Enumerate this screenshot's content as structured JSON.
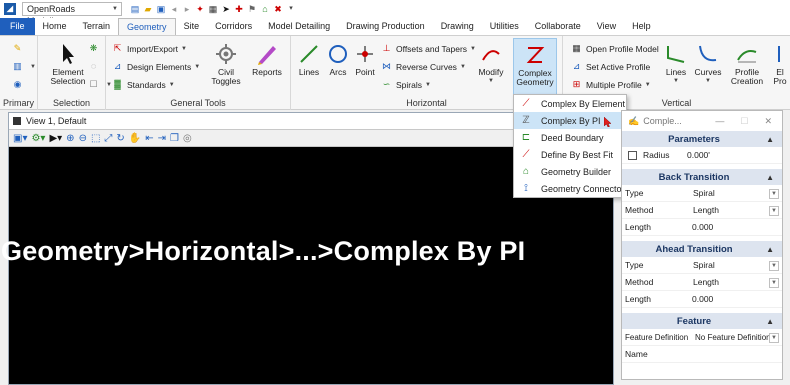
{
  "titlebar": {
    "workspace": "OpenRoads Modeling"
  },
  "tabs": [
    "File",
    "Home",
    "Terrain",
    "Geometry",
    "Site",
    "Corridors",
    "Model Detailing",
    "Drawing Production",
    "Drawing",
    "Utilities",
    "Collaborate",
    "View",
    "Help"
  ],
  "ribbon": {
    "groups": {
      "primary": "Primary",
      "selection": "Selection",
      "general_tools": "General Tools",
      "horizontal": "Horizontal",
      "vertical": "Vertical"
    },
    "buttons": {
      "element_selection": "Element\nSelection",
      "import_export": "Import/Export",
      "design_elements": "Design Elements",
      "standards": "Standards",
      "civil_toggles": "Civil\nToggles",
      "reports": "Reports",
      "lines": "Lines",
      "arcs": "Arcs",
      "point": "Point",
      "offsets_tapers": "Offsets and Tapers",
      "reverse_curves": "Reverse Curves",
      "spirals": "Spirals",
      "modify": "Modify",
      "complex_geometry": "Complex\nGeometry",
      "open_profile_model": "Open Profile Model",
      "set_active_profile": "Set Active Profile",
      "multiple_profile": "Multiple Profile",
      "v_lines": "Lines",
      "v_curves": "Curves",
      "profile_creation": "Profile\nCreation",
      "el_cut": "El",
      "pro_cut": "Pro"
    }
  },
  "view": {
    "title": "View 1, Default",
    "overlay": "Geometry>Horizontal>...>Complex By PI"
  },
  "menu": {
    "items": [
      {
        "label": "Complex By Element",
        "icon": "complex-element-icon"
      },
      {
        "label": "Complex By PI",
        "icon": "complex-pi-icon"
      },
      {
        "label": "Deed Boundary",
        "icon": "deed-boundary-icon"
      },
      {
        "label": "Define By Best Fit",
        "icon": "best-fit-icon"
      },
      {
        "label": "Geometry Builder",
        "icon": "geometry-builder-icon"
      },
      {
        "label": "Geometry Connector",
        "icon": "geometry-connector-icon"
      }
    ],
    "highlighted_index": 1
  },
  "panel": {
    "title": "Comple...",
    "sections": {
      "parameters": {
        "title": "Parameters",
        "radius_label": "Radius",
        "radius_value": "0.000'"
      },
      "back_transition": {
        "title": "Back Transition",
        "type_label": "Type",
        "type_value": "Spiral",
        "method_label": "Method",
        "method_value": "Length",
        "length_label": "Length",
        "length_value": "0.000"
      },
      "ahead_transition": {
        "title": "Ahead Transition",
        "type_label": "Type",
        "type_value": "Spiral",
        "method_label": "Method",
        "method_value": "Length",
        "length_label": "Length",
        "length_value": "0.000"
      },
      "feature": {
        "title": "Feature",
        "def_label": "Feature Definition",
        "def_value": "No Feature Definition",
        "name_label": "Name",
        "name_value": ""
      }
    }
  },
  "colors": {
    "accent": "#1f5fbd",
    "section_bg": "#dde4ef",
    "highlight": "#cce4f7",
    "canvas": "#000000"
  }
}
